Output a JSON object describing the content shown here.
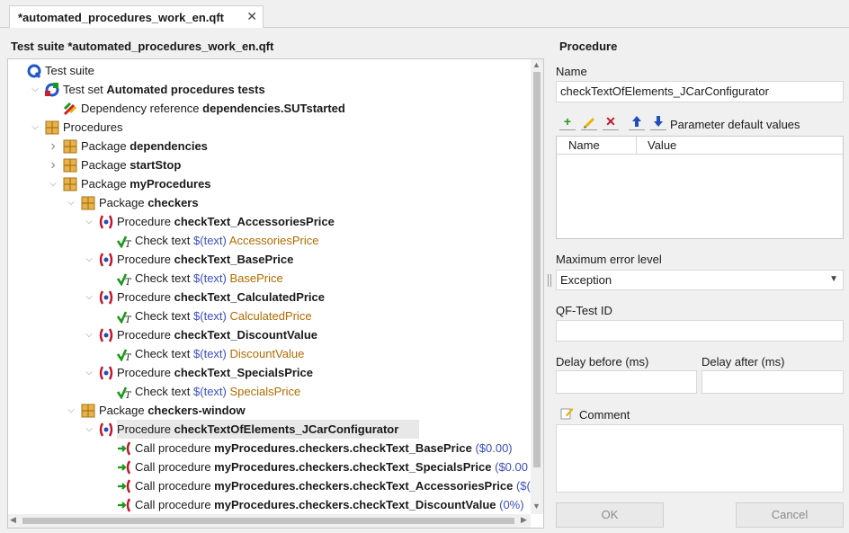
{
  "tab": {
    "title": "*automated_procedures_work_en.qft",
    "close": "✕"
  },
  "tree": {
    "title": "Test suite *automated_procedures_work_en.qft",
    "rows": [
      {
        "lbl": "Test suite",
        "bold": ""
      },
      {
        "lbl": "Test set ",
        "bold": "Automated procedures tests"
      },
      {
        "lbl": "Dependency reference ",
        "bold": "dependencies.SUTstarted"
      },
      {
        "lbl": "Procedures",
        "bold": ""
      },
      {
        "lbl": "Package ",
        "bold": "dependencies"
      },
      {
        "lbl": "Package ",
        "bold": "startStop"
      },
      {
        "lbl": "Package ",
        "bold": "myProcedures"
      },
      {
        "lbl": "Package ",
        "bold": "checkers"
      },
      {
        "lbl": "Procedure ",
        "bold": "checkText_AccessoriesPrice"
      },
      {
        "lbl": "Check text ",
        "var": "$(text)",
        "str": "AccessoriesPrice"
      },
      {
        "lbl": "Procedure ",
        "bold": "checkText_BasePrice"
      },
      {
        "lbl": "Check text ",
        "var": "$(text)",
        "str": "BasePrice"
      },
      {
        "lbl": "Procedure ",
        "bold": "checkText_CalculatedPrice"
      },
      {
        "lbl": "Check text ",
        "var": "$(text)",
        "str": "CalculatedPrice"
      },
      {
        "lbl": "Procedure ",
        "bold": "checkText_DiscountValue"
      },
      {
        "lbl": "Check text ",
        "var": "$(text)",
        "str": "DiscountValue"
      },
      {
        "lbl": "Procedure ",
        "bold": "checkText_SpecialsPrice"
      },
      {
        "lbl": "Check text ",
        "var": "$(text)",
        "str": "SpecialsPrice"
      },
      {
        "lbl": "Package ",
        "bold": "checkers-window"
      },
      {
        "lbl": "Procedure ",
        "bold": "checkTextOfElements_JCarConfigurator"
      },
      {
        "lbl": "Call procedure ",
        "bold": "myProcedures.checkers.checkText_BasePrice",
        "par": " ($0.00)"
      },
      {
        "lbl": "Call procedure ",
        "bold": "myProcedures.checkers.checkText_SpecialsPrice",
        "par": " ($0.00"
      },
      {
        "lbl": "Call procedure ",
        "bold": "myProcedures.checkers.checkText_AccessoriesPrice",
        "par": " ($("
      },
      {
        "lbl": "Call procedure ",
        "bold": "myProcedures.checkers.checkText_DiscountValue",
        "par": " (0%)"
      }
    ]
  },
  "details": {
    "heading": "Procedure",
    "name_label": "Name",
    "name_value": "checkTextOfElements_JCarConfigurator",
    "param_label": "Parameter default values",
    "param_col_name": "Name",
    "param_col_value": "Value",
    "max_error_label": "Maximum error level",
    "max_error_value": "Exception",
    "qf_id_label": "QF-Test ID",
    "delay_before_label": "Delay before (ms)",
    "delay_after_label": "Delay after (ms)",
    "comment_label": "Comment",
    "ok_label": "OK",
    "cancel_label": "Cancel"
  },
  "icons": {
    "suite": "test-suite-icon",
    "set": "test-set-icon",
    "dependency": "dependency-reference-icon",
    "package": "package-icon",
    "procedure": "procedure-icon",
    "check": "check-text-icon",
    "call": "call-procedure-icon"
  },
  "colors": {
    "variable": "#3c4fc0",
    "string": "#b06b00",
    "procedure_red": "#c0162b",
    "check_green": "#1a9a1a"
  }
}
